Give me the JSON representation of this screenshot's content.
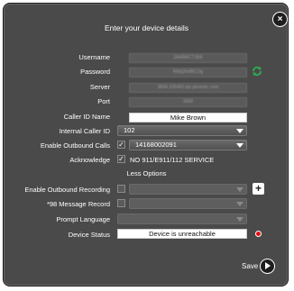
{
  "dialog": {
    "title": "Enter your device details",
    "close_symbol": "×"
  },
  "fields": {
    "username_label": "Username",
    "username_value": "2AABAC71BA",
    "password_label": "Password",
    "password_value": "R6bj2hdf8COg",
    "server_label": "Server",
    "server_value": "9834.155450.sip.yboxsec.com",
    "port_label": "Port",
    "port_value": "3060",
    "caller_id_name_label": "Caller ID Name",
    "caller_id_name_value": "Mike Brown",
    "internal_caller_id_label": "Internal Caller ID",
    "internal_caller_id_value": "102",
    "enable_outbound_label": "Enable Outbound Calls",
    "enable_outbound_checked": "✓",
    "enable_outbound_value": "14168002091",
    "acknowledge_label": "Acknowledge",
    "acknowledge_checked": "✓",
    "acknowledge_text": "NO 911/E911/112 SERVICE"
  },
  "less_options": {
    "label": "Less Options",
    "outbound_recording_label": "Enable Outbound Recording",
    "message_record_label": "*98 Message Record",
    "prompt_language_label": "Prompt Language",
    "device_status_label": "Device Status",
    "device_status_value": "Device is unreachable",
    "plus_symbol": "+"
  },
  "footer": {
    "save_label": "Save"
  },
  "colors": {
    "dialog_bg": "#4a4a4a",
    "refresh_green": "#2fa84f",
    "status_red": "#e01010"
  },
  "icons": [
    "close-icon",
    "refresh-icon",
    "add-icon",
    "status-indicator-icon",
    "play-icon",
    "chevron-down-icon"
  ]
}
